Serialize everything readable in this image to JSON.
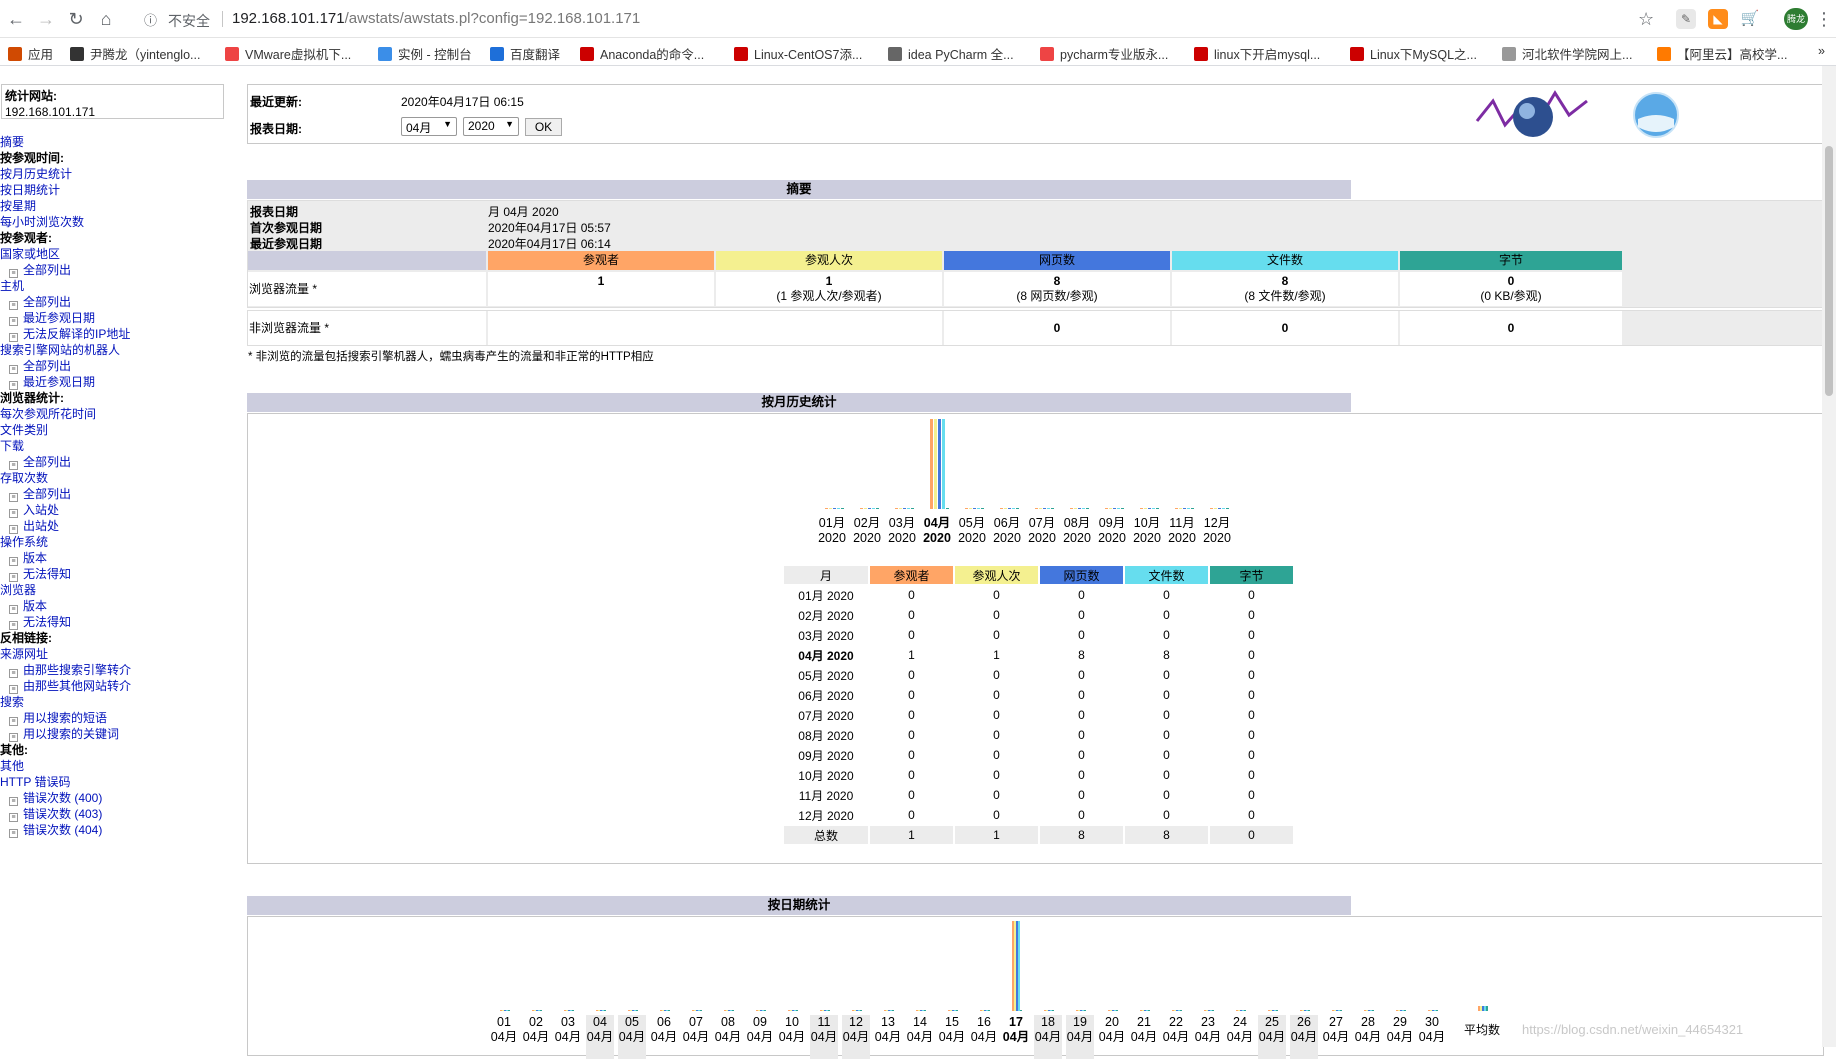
{
  "browser": {
    "security_label": "不安全",
    "url_host": "192.168.101.171",
    "url_path": "/awstats/awstats.pl?config=192.168.101.171",
    "bookmarks": [
      "应用",
      "尹腾龙（yintenglo...",
      "VMware虚拟机下...",
      "实例 - 控制台",
      "百度翻译",
      "Anaconda的命令...",
      "Linux-CentOS7添...",
      "idea PyCharm 全...",
      "pycharm专业版永...",
      "linux下开启mysql...",
      "Linux下MySQL之...",
      "河北软件学院网上...",
      "【阿里云】高校学..."
    ],
    "avatar_text": "腾龙"
  },
  "sidebar": {
    "site_label": "统计网站:",
    "site_value": "192.168.101.171",
    "items": [
      {
        "type": "link",
        "label": "摘要"
      },
      {
        "type": "head",
        "label": "按参观时间:"
      },
      {
        "type": "link",
        "label": "按月历史统计"
      },
      {
        "type": "link",
        "label": "按日期统计"
      },
      {
        "type": "link",
        "label": "按星期"
      },
      {
        "type": "link",
        "label": "每小时浏览次数"
      },
      {
        "type": "head",
        "label": "按参观者:"
      },
      {
        "type": "link",
        "label": "国家或地区"
      },
      {
        "type": "sub",
        "label": "全部列出"
      },
      {
        "type": "link",
        "label": "主机"
      },
      {
        "type": "sub",
        "label": "全部列出"
      },
      {
        "type": "sub",
        "label": "最近参观日期"
      },
      {
        "type": "sub",
        "label": "无法反解译的IP地址"
      },
      {
        "type": "link",
        "label": "搜索引擎网站的机器人"
      },
      {
        "type": "sub",
        "label": "全部列出"
      },
      {
        "type": "sub",
        "label": "最近参观日期"
      },
      {
        "type": "head",
        "label": "浏览器统计:"
      },
      {
        "type": "link",
        "label": "每次参观所花时间"
      },
      {
        "type": "link",
        "label": "文件类别"
      },
      {
        "type": "link",
        "label": "下载"
      },
      {
        "type": "sub",
        "label": "全部列出"
      },
      {
        "type": "link",
        "label": "存取次数"
      },
      {
        "type": "sub",
        "label": "全部列出"
      },
      {
        "type": "sub",
        "label": "入站处"
      },
      {
        "type": "sub",
        "label": "出站处"
      },
      {
        "type": "link",
        "label": "操作系统"
      },
      {
        "type": "sub",
        "label": "版本"
      },
      {
        "type": "sub",
        "label": "无法得知"
      },
      {
        "type": "link",
        "label": "浏览器"
      },
      {
        "type": "sub",
        "label": "版本"
      },
      {
        "type": "sub",
        "label": "无法得知"
      },
      {
        "type": "head",
        "label": "反相链接:"
      },
      {
        "type": "link",
        "label": "来源网址"
      },
      {
        "type": "sub",
        "label": "由那些搜索引擎转介"
      },
      {
        "type": "sub",
        "label": "由那些其他网站转介"
      },
      {
        "type": "link",
        "label": "搜索"
      },
      {
        "type": "sub",
        "label": "用以搜索的短语"
      },
      {
        "type": "sub",
        "label": "用以搜索的关键词"
      },
      {
        "type": "head",
        "label": "其他:"
      },
      {
        "type": "link",
        "label": "其他"
      },
      {
        "type": "link",
        "label": "HTTP 错误码"
      },
      {
        "type": "sub",
        "label": "错误次数 (400)"
      },
      {
        "type": "sub",
        "label": "错误次数 (403)"
      },
      {
        "type": "sub",
        "label": "错误次数 (404)"
      }
    ]
  },
  "header": {
    "last_update_label": "最近更新:",
    "last_update_value": "2020年04月17日 06:15",
    "report_date_label": "报表日期:",
    "month_select": "04月",
    "year_select": "2020",
    "ok_label": "OK"
  },
  "summary": {
    "title": "摘要",
    "report_date_label": "报表日期",
    "report_date_value": "月 04月 2020",
    "first_visit_label": "首次参观日期",
    "first_visit_value": "2020年04月17日 05:57",
    "last_visit_label": "最近参观日期",
    "last_visit_value": "2020年04月17日 06:14",
    "col_visitors": "参观者",
    "col_visits": "参观人次",
    "col_pages": "网页数",
    "col_hits": "文件数",
    "col_bytes": "字节",
    "browser_traffic_label": "浏览器流量 *",
    "visitors_value": "1",
    "visits_value": "1",
    "visits_sub": "(1 参观人次/参观者)",
    "pages_value": "8",
    "pages_sub": "(8 网页数/参观)",
    "hits_value": "8",
    "hits_sub": "(8 文件数/参观)",
    "bytes_value": "0",
    "bytes_sub": "(0 KB/参观)",
    "nonbrowser_label": "非浏览器流量 *",
    "nb_pages": "0",
    "nb_hits": "0",
    "nb_bytes": "0",
    "footnote": "* 非浏览的流量包括搜索引擎机器人，蠕虫病毒产生的流量和非正常的HTTP相应"
  },
  "colors": {
    "visitors": "#ffa566",
    "visits": "#f4f090",
    "pages": "#4477dd",
    "hits": "#66ddee",
    "bytes": "#2ea495"
  },
  "monthly": {
    "title": "按月历史统计",
    "col_month": "月",
    "total_label": "总数",
    "rows": [
      {
        "month": "01月 2020",
        "visitors": "0",
        "visits": "0",
        "pages": "0",
        "hits": "0",
        "bytes": "0"
      },
      {
        "month": "02月 2020",
        "visitors": "0",
        "visits": "0",
        "pages": "0",
        "hits": "0",
        "bytes": "0"
      },
      {
        "month": "03月 2020",
        "visitors": "0",
        "visits": "0",
        "pages": "0",
        "hits": "0",
        "bytes": "0"
      },
      {
        "month": "04月 2020",
        "visitors": "1",
        "visits": "1",
        "pages": "8",
        "hits": "8",
        "bytes": "0"
      },
      {
        "month": "05月 2020",
        "visitors": "0",
        "visits": "0",
        "pages": "0",
        "hits": "0",
        "bytes": "0"
      },
      {
        "month": "06月 2020",
        "visitors": "0",
        "visits": "0",
        "pages": "0",
        "hits": "0",
        "bytes": "0"
      },
      {
        "month": "07月 2020",
        "visitors": "0",
        "visits": "0",
        "pages": "0",
        "hits": "0",
        "bytes": "0"
      },
      {
        "month": "08月 2020",
        "visitors": "0",
        "visits": "0",
        "pages": "0",
        "hits": "0",
        "bytes": "0"
      },
      {
        "month": "09月 2020",
        "visitors": "0",
        "visits": "0",
        "pages": "0",
        "hits": "0",
        "bytes": "0"
      },
      {
        "month": "10月 2020",
        "visitors": "0",
        "visits": "0",
        "pages": "0",
        "hits": "0",
        "bytes": "0"
      },
      {
        "month": "11月 2020",
        "visitors": "0",
        "visits": "0",
        "pages": "0",
        "hits": "0",
        "bytes": "0"
      },
      {
        "month": "12月 2020",
        "visitors": "0",
        "visits": "0",
        "pages": "0",
        "hits": "0",
        "bytes": "0"
      }
    ],
    "total": {
      "visitors": "1",
      "visits": "1",
      "pages": "8",
      "hits": "8",
      "bytes": "0"
    },
    "chart_labels": [
      [
        "01月",
        "2020"
      ],
      [
        "02月",
        "2020"
      ],
      [
        "03月",
        "2020"
      ],
      [
        "04月",
        "2020"
      ],
      [
        "05月",
        "2020"
      ],
      [
        "06月",
        "2020"
      ],
      [
        "07月",
        "2020"
      ],
      [
        "08月",
        "2020"
      ],
      [
        "09月",
        "2020"
      ],
      [
        "10月",
        "2020"
      ],
      [
        "11月",
        "2020"
      ],
      [
        "12月",
        "2020"
      ]
    ],
    "current_index": 3
  },
  "daily": {
    "title": "按日期统计",
    "days": [
      "01",
      "02",
      "03",
      "04",
      "05",
      "06",
      "07",
      "08",
      "09",
      "10",
      "11",
      "12",
      "13",
      "14",
      "15",
      "16",
      "17",
      "18",
      "19",
      "20",
      "21",
      "22",
      "23",
      "24",
      "25",
      "26",
      "27",
      "28",
      "29",
      "30"
    ],
    "month_label": "04月",
    "weekend_days": [
      "04",
      "05",
      "11",
      "12",
      "18",
      "19",
      "25",
      "26"
    ],
    "current_day": "17",
    "avg_label": "平均数"
  },
  "watermark": "https://blog.csdn.net/weixin_44654321"
}
